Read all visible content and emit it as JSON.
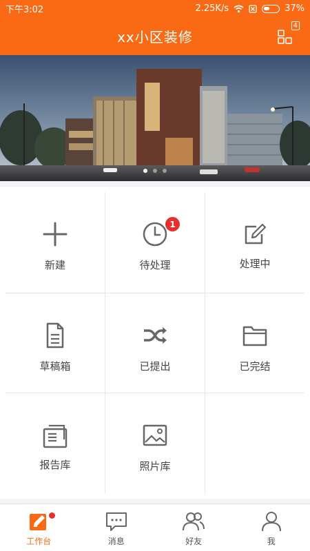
{
  "status": {
    "time": "下午3:02",
    "speed": "2.25K/s",
    "battery": "37%"
  },
  "header": {
    "title": "xx小区装修",
    "grid_count": "4"
  },
  "tiles": [
    {
      "label": "新建",
      "icon": "plus-icon"
    },
    {
      "label": "待处理",
      "icon": "clock-icon",
      "badge": "1"
    },
    {
      "label": "处理中",
      "icon": "edit-icon"
    },
    {
      "label": "草稿箱",
      "icon": "document-icon"
    },
    {
      "label": "已提出",
      "icon": "shuffle-icon"
    },
    {
      "label": "已完结",
      "icon": "folder-icon"
    },
    {
      "label": "报告库",
      "icon": "report-icon"
    },
    {
      "label": "照片库",
      "icon": "image-icon"
    }
  ],
  "tabs": [
    {
      "label": "工作台",
      "icon": "workbench-icon",
      "active": true
    },
    {
      "label": "消息",
      "icon": "message-icon"
    },
    {
      "label": "好友",
      "icon": "friends-icon"
    },
    {
      "label": "我",
      "icon": "person-icon"
    }
  ],
  "colors": {
    "accent": "#fa6a14",
    "badge": "#e5302b",
    "icon": "#666666"
  }
}
